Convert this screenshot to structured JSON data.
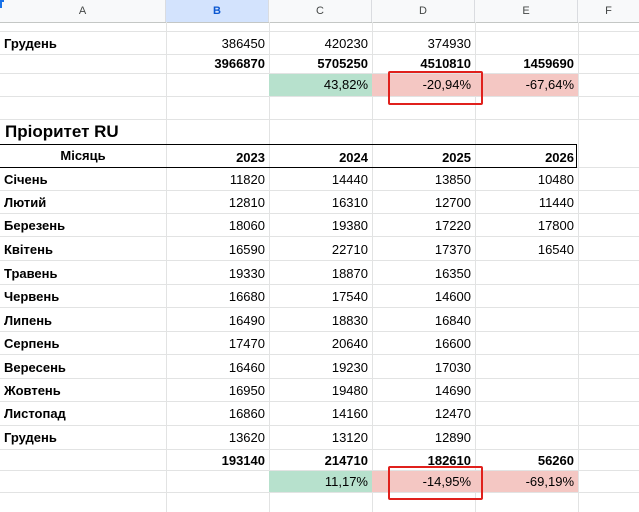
{
  "columns": [
    "A",
    "B",
    "C",
    "D",
    "E",
    "F"
  ],
  "selected_column": "B",
  "top_block": {
    "rows": [
      {
        "month": "Грудень",
        "b": "386450",
        "c": "420230",
        "d": "374930",
        "e": ""
      },
      {
        "month": "",
        "b": "3966870",
        "c": "5705250",
        "d": "4510810",
        "e": "1459690",
        "bold": true
      }
    ],
    "pct": {
      "c": "43,82%",
      "d": "-20,94%",
      "e": "-67,64%"
    }
  },
  "ru_block": {
    "title": "Пріоритет RU",
    "header": {
      "month": "Місяць",
      "y2023": "2023",
      "y2024": "2024",
      "y2025": "2025",
      "y2026": "2026"
    },
    "rows": [
      {
        "month": "Січень",
        "b": "11820",
        "c": "14440",
        "d": "13850",
        "e": "10480"
      },
      {
        "month": "Лютий",
        "b": "12810",
        "c": "16310",
        "d": "12700",
        "e": "11440"
      },
      {
        "month": "Березень",
        "b": "18060",
        "c": "19380",
        "d": "17220",
        "e": "17800"
      },
      {
        "month": "Квітень",
        "b": "16590",
        "c": "22710",
        "d": "17370",
        "e": "16540"
      },
      {
        "month": "Травень",
        "b": "19330",
        "c": "18870",
        "d": "16350",
        "e": ""
      },
      {
        "month": "Червень",
        "b": "16680",
        "c": "17540",
        "d": "14600",
        "e": ""
      },
      {
        "month": "Липень",
        "b": "16490",
        "c": "18830",
        "d": "16840",
        "e": ""
      },
      {
        "month": "Серпень",
        "b": "17470",
        "c": "20640",
        "d": "16600",
        "e": ""
      },
      {
        "month": "Вересень",
        "b": "16460",
        "c": "19230",
        "d": "17030",
        "e": ""
      },
      {
        "month": "Жовтень",
        "b": "16950",
        "c": "19480",
        "d": "14690",
        "e": ""
      },
      {
        "month": "Листопад",
        "b": "16860",
        "c": "14160",
        "d": "12470",
        "e": ""
      },
      {
        "month": "Грудень",
        "b": "13620",
        "c": "13120",
        "d": "12890",
        "e": ""
      }
    ],
    "totals": {
      "b": "193140",
      "c": "214710",
      "d": "182610",
      "e": "56260"
    },
    "pct": {
      "c": "11,17%",
      "d": "-14,95%",
      "e": "-69,19%"
    }
  },
  "colors": {
    "positive_fill": "#b7e1cd",
    "negative_fill": "#f4c7c3",
    "highlight_box": "#e0201c",
    "selected_header": "#d3e3fd"
  }
}
